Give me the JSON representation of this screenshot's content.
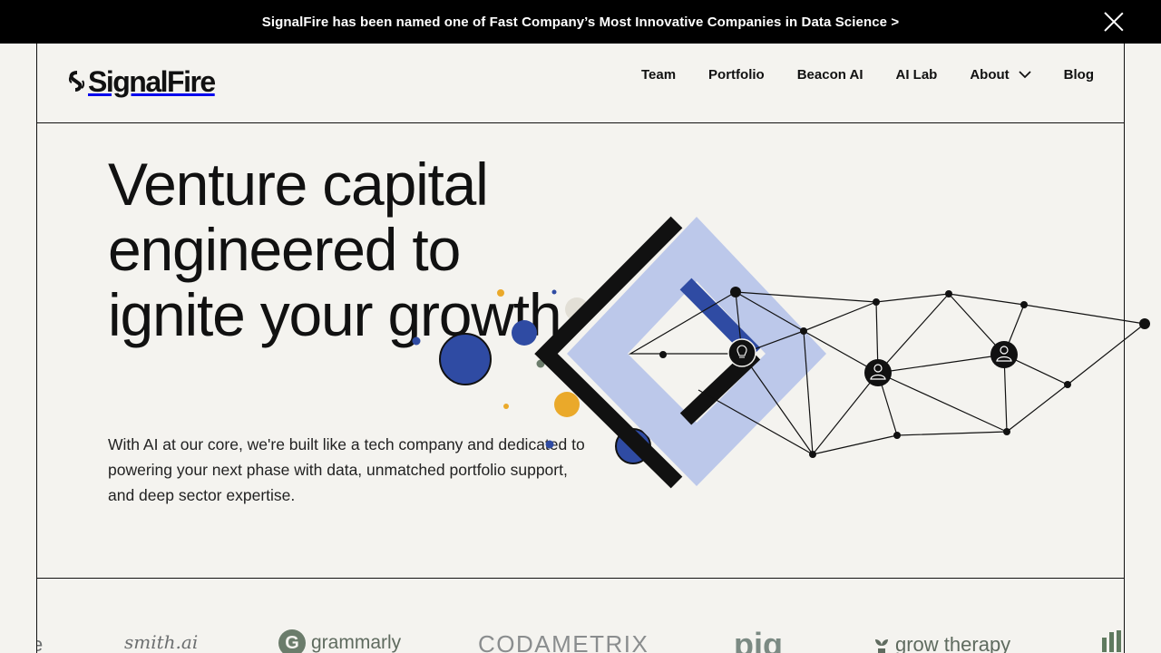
{
  "announcement": {
    "text": "SignalFire has been named one of Fast Company’s Most Innovative Companies in Data Science >"
  },
  "header": {
    "logo_text": "SignalFire",
    "nav": [
      {
        "label": "Team"
      },
      {
        "label": "Portfolio"
      },
      {
        "label": "Beacon AI"
      },
      {
        "label": "AI Lab"
      },
      {
        "label": "About"
      },
      {
        "label": "Blog"
      }
    ]
  },
  "hero": {
    "title": "Venture capital engineered to ignite your growth",
    "subtitle": "With AI at our core, we're built like a tech company and dedicated to powering your next phase with data, unmatched portfolio support, and deep sector expertise."
  },
  "portfolio_logos": [
    {
      "label": "e"
    },
    {
      "label": "smith.ai"
    },
    {
      "label": "grammarly"
    },
    {
      "label": "CODAMETRIX"
    },
    {
      "label": "pig"
    },
    {
      "label": "grow therapy"
    }
  ],
  "colors": {
    "background": "#f4f3ef",
    "announcement_bg": "#000000",
    "accent_blue": "#2f4ba3",
    "light_blue": "#bcc8ea",
    "accent_yellow": "#eaa92a",
    "muted_green": "#6b7c6b"
  }
}
